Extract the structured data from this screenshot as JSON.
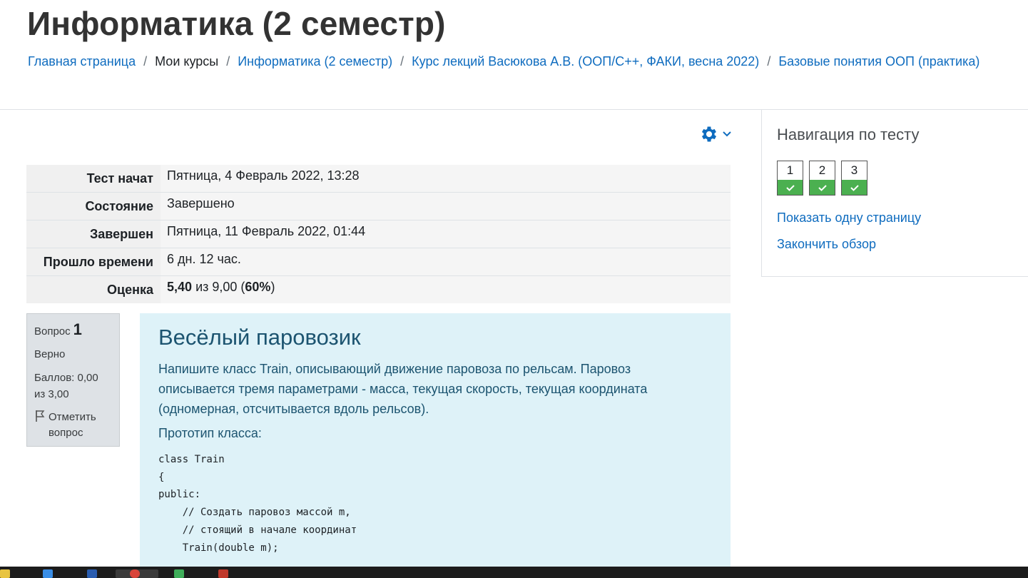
{
  "page_title": "Информатика (2 семестр)",
  "breadcrumb": [
    {
      "label": "Главная страница",
      "link": true
    },
    {
      "label": "Мои курсы",
      "link": false
    },
    {
      "label": "Информатика (2 семестр)",
      "link": true
    },
    {
      "label": "Курс лекций Васюкова А.В. (ООП/С++, ФАКИ, весна 2022)",
      "link": true
    },
    {
      "label": "Базовые понятия ООП (практика)",
      "link": true
    }
  ],
  "breadcrumb_separator": "/",
  "gear_menu": {
    "icon": "gear-icon",
    "caret": "chevron-down-icon",
    "color": "#0f6cbf"
  },
  "summary": [
    {
      "label": "Тест начат",
      "value": "Пятница, 4 Февраль 2022, 13:28"
    },
    {
      "label": "Состояние",
      "value": "Завершено"
    },
    {
      "label": "Завершен",
      "value": "Пятница, 11 Февраль 2022, 01:44"
    },
    {
      "label": "Прошло времени",
      "value": "6 дн. 12 час."
    },
    {
      "label": "Оценка",
      "grade": "5,40",
      "of_text": "из 9,00 (",
      "percent": "60%",
      "close": ")"
    }
  ],
  "question_info": {
    "prefix": "Вопрос",
    "number": "1",
    "state": "Верно",
    "marks": "Баллов: 0,00 из 3,00",
    "flag_label": "Отметить вопрос"
  },
  "question": {
    "title": "Весёлый паровозик",
    "text": "Напишите класс Train, описывающий движение паровоза по рельсам. Паровоз описывается тремя параметрами - масса, текущая скорость, текущая координата (одномерная, отсчитывается вдоль рельсов).",
    "proto_label": "Прототип класса:",
    "code": [
      "class Train",
      "{",
      "public:",
      "    // Создать паровоз массой m,",
      "    // стоящий в начале координат",
      "    Train(double m);"
    ]
  },
  "sidebar": {
    "title": "Навигация по тесту",
    "questions": [
      {
        "label": "1",
        "status": "correct"
      },
      {
        "label": "2",
        "status": "correct"
      },
      {
        "label": "3",
        "status": "correct"
      }
    ],
    "show_one_page": "Показать одну страницу",
    "finish_review": "Закончить обзор"
  },
  "colors": {
    "link": "#0f6cbf",
    "correct": "#4bb050",
    "question_bg": "#def2f8",
    "question_text": "#1c5470"
  }
}
